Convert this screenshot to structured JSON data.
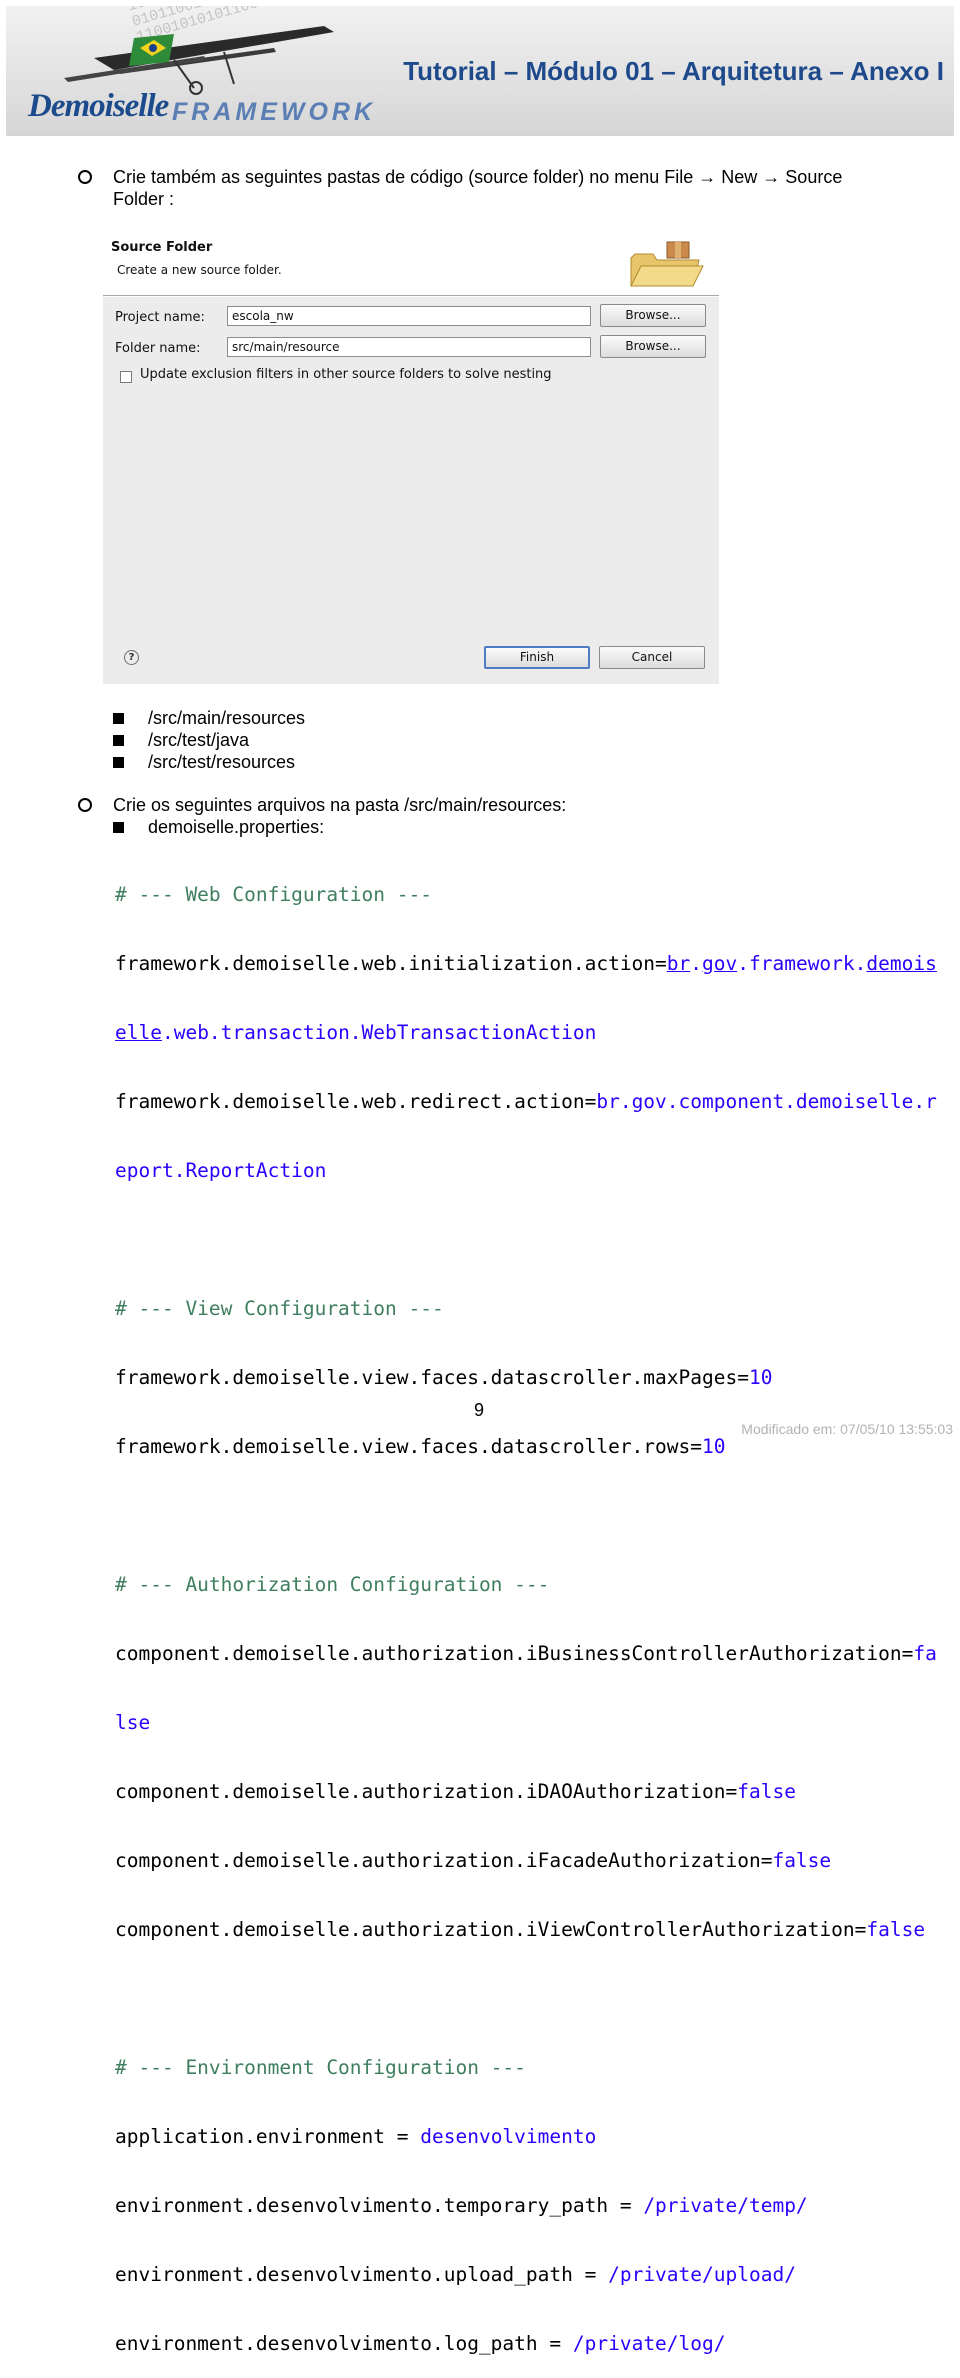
{
  "header": {
    "logo_word": "Demoiselle",
    "logo_framework": "FRAMEWORK",
    "title": "Tutorial – Módulo 01 – Arquitetura – Anexo I",
    "digits": "1010110100101001\n0101100101011010\n1100101010110010"
  },
  "intro": {
    "line1": "Crie também as seguintes pastas de código (source folder) no menu File → New → Source",
    "line2": "Folder :"
  },
  "dialog": {
    "title": "Source Folder",
    "subtitle": "Create a new source folder.",
    "project_label": "Project name:",
    "project_value": "escola_nw",
    "folder_label": "Folder name:",
    "folder_value": "src/main/resource",
    "browse_label": "Browse...",
    "checkbox_label": "Update exclusion filters in other source folders to solve nesting",
    "finish_label": "Finish",
    "cancel_label": "Cancel",
    "help_glyph": "?"
  },
  "folders": [
    "/src/main/resources",
    "/src/test/java",
    "/src/test/resources"
  ],
  "files_intro": "Crie os seguintes arquivos na pasta /src/main/resources:",
  "file_name": "demoiselle.properties:",
  "code": {
    "web_comment": "# --- Web Configuration ---",
    "init_key": "framework.demoiselle.web.initialization.action=",
    "init_v1": "br",
    "init_dot1": ".",
    "init_v2": "gov",
    "init_v3": ".framework.",
    "init_v4": "demois",
    "init_v5": "elle",
    "init_v6": ".web.transaction.WebTransactionAction",
    "redirect_key": "framework.demoiselle.web.redirect.action=",
    "redirect_v1": "br.gov.component.demoiselle.r",
    "redirect_v2": "eport.ReportAction",
    "view_comment": "# --- View Configuration ---",
    "maxpages_key": "framework.demoiselle.view.faces.datascroller.maxPages=",
    "maxpages_val": "10",
    "rows_key": "framework.demoiselle.view.faces.datascroller.rows=",
    "rows_val": "10",
    "auth_comment": "# --- Authorization Configuration ---",
    "auth1_key": "component.demoiselle.authorization.iBusinessControllerAuthorization=",
    "auth1_v1": "fa",
    "auth1_v2": "lse",
    "auth2_key": "component.demoiselle.authorization.iDAOAuthorization=",
    "auth2_val": "false",
    "auth3_key": "component.demoiselle.authorization.iFacadeAuthorization=",
    "auth3_val": "false",
    "auth4_key": "component.demoiselle.authorization.iViewControllerAuthorization=",
    "auth4_val": "false",
    "env_comment": "# --- Environment Configuration ---",
    "env_key": "application.environment = ",
    "env_val": "desenvolvimento",
    "temp_key": "environment.desenvolvimento.temporary_path = ",
    "temp_val": "/private/temp/",
    "upload_key": "environment.desenvolvimento.upload_path = ",
    "upload_val": "/private/upload/",
    "log_key": "environment.desenvolvimento.log_path = ",
    "log_val": "/private/log/"
  },
  "footer": {
    "page_number": "9",
    "modified": "Modificado em: 07/05/10 13:55:03"
  },
  "colors": {
    "title_blue": "#1e4a8c",
    "code_comment": "#3f7f5f",
    "code_value": "#2a00ff"
  }
}
